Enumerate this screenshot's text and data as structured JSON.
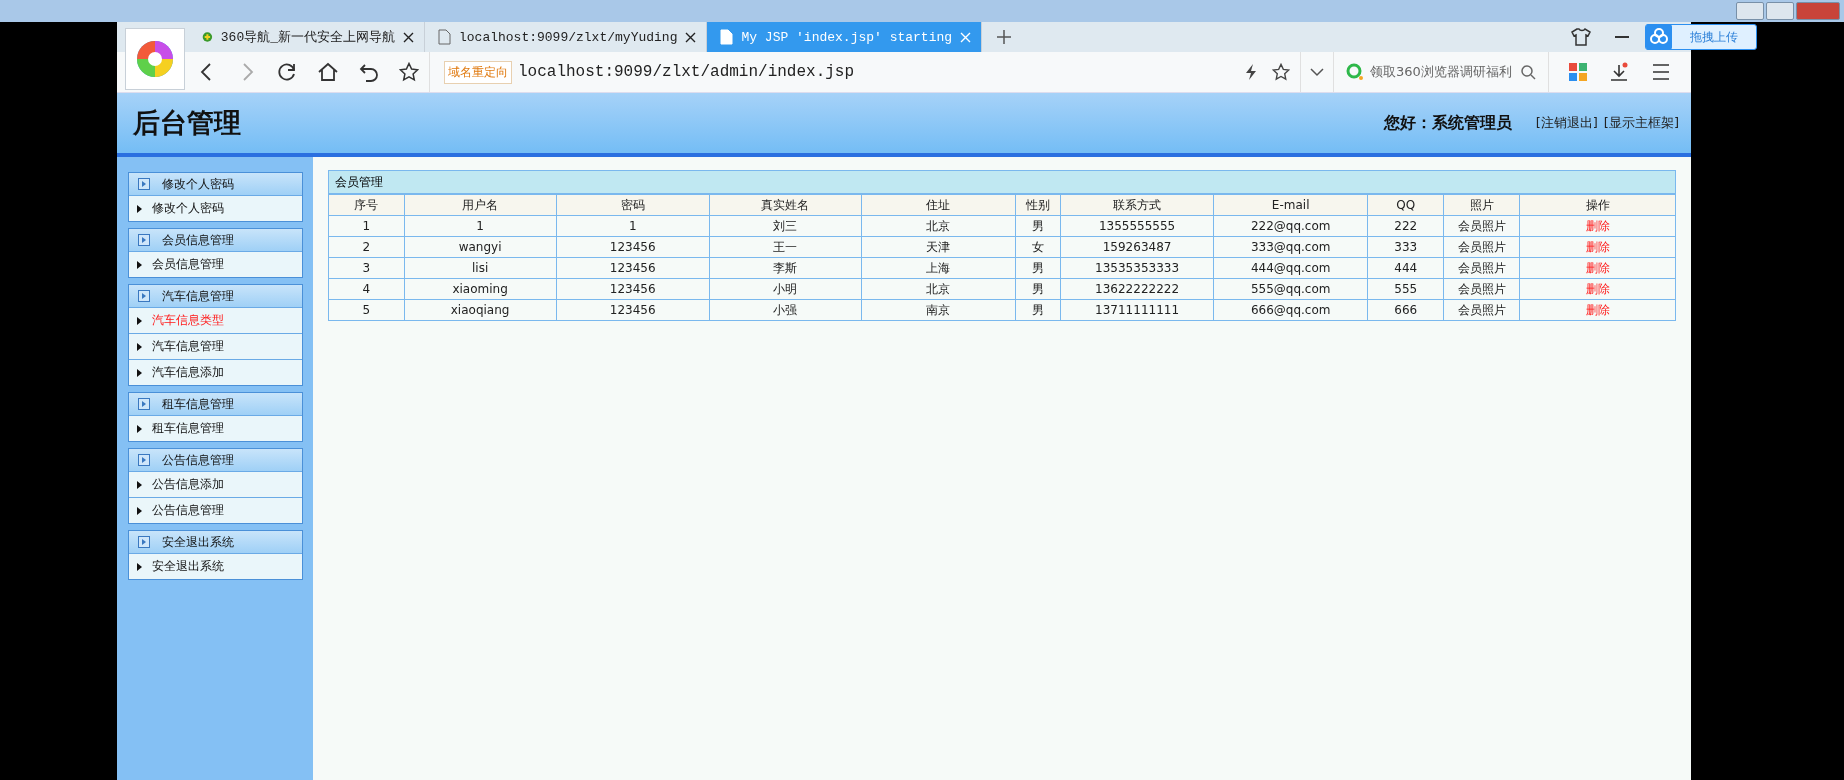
{
  "browser": {
    "tabs": [
      {
        "title": "360导航_新一代安全上网导航",
        "kind": "site",
        "selected": false
      },
      {
        "title": "localhost:9099/zlxt/myYuding",
        "kind": "page",
        "selected": false
      },
      {
        "title": "My JSP 'index.jsp' starting",
        "kind": "page",
        "selected": true
      }
    ],
    "redirect_badge": "域名重定向",
    "url": "localhost:9099/zlxt/admin/index.jsp",
    "search_hint": "领取360浏览器调研福利",
    "upload_button": "拖拽上传"
  },
  "header": {
    "title": "后台管理",
    "greeting": "您好：系统管理员",
    "links": [
      "[注销退出]",
      "[显示主框架]"
    ]
  },
  "sidebar": {
    "groups": [
      {
        "title": "修改个人密码",
        "items": [
          {
            "label": "修改个人密码",
            "selected": false
          }
        ]
      },
      {
        "title": "会员信息管理",
        "items": [
          {
            "label": "会员信息管理",
            "selected": false
          }
        ]
      },
      {
        "title": "汽车信息管理",
        "items": [
          {
            "label": "汽车信息类型",
            "selected": true
          },
          {
            "label": "汽车信息管理",
            "selected": false
          },
          {
            "label": "汽车信息添加",
            "selected": false
          }
        ]
      },
      {
        "title": "租车信息管理",
        "items": [
          {
            "label": "租车信息管理",
            "selected": false
          }
        ]
      },
      {
        "title": "公告信息管理",
        "items": [
          {
            "label": "公告信息添加",
            "selected": false
          },
          {
            "label": "公告信息管理",
            "selected": false
          }
        ]
      },
      {
        "title": "安全退出系统",
        "items": [
          {
            "label": "安全退出系统",
            "selected": false
          }
        ]
      }
    ]
  },
  "panel": {
    "title": "会员管理",
    "table": {
      "columns": [
        "序号",
        "用户名",
        "密码",
        "真实姓名",
        "住址",
        "性别",
        "联系方式",
        "E-mail",
        "QQ",
        "照片",
        "操作"
      ],
      "rows": [
        [
          "1",
          "1",
          "1",
          "刘三",
          "北京",
          "男",
          "1355555555",
          "222@qq.com",
          "222",
          "会员照片",
          "删除"
        ],
        [
          "2",
          "wangyi",
          "123456",
          "王一",
          "天津",
          "女",
          "159263487",
          "333@qq.com",
          "333",
          "会员照片",
          "删除"
        ],
        [
          "3",
          "lisi",
          "123456",
          "李斯",
          "上海",
          "男",
          "13535353333",
          "444@qq.com",
          "444",
          "会员照片",
          "删除"
        ],
        [
          "4",
          "xiaoming",
          "123456",
          "小明",
          "北京",
          "男",
          "13622222222",
          "555@qq.com",
          "555",
          "会员照片",
          "删除"
        ],
        [
          "5",
          "xiaoqiang",
          "123456",
          "小强",
          "南京",
          "男",
          "13711111111",
          "666@qq.com",
          "666",
          "会员照片",
          "删除"
        ]
      ]
    }
  }
}
